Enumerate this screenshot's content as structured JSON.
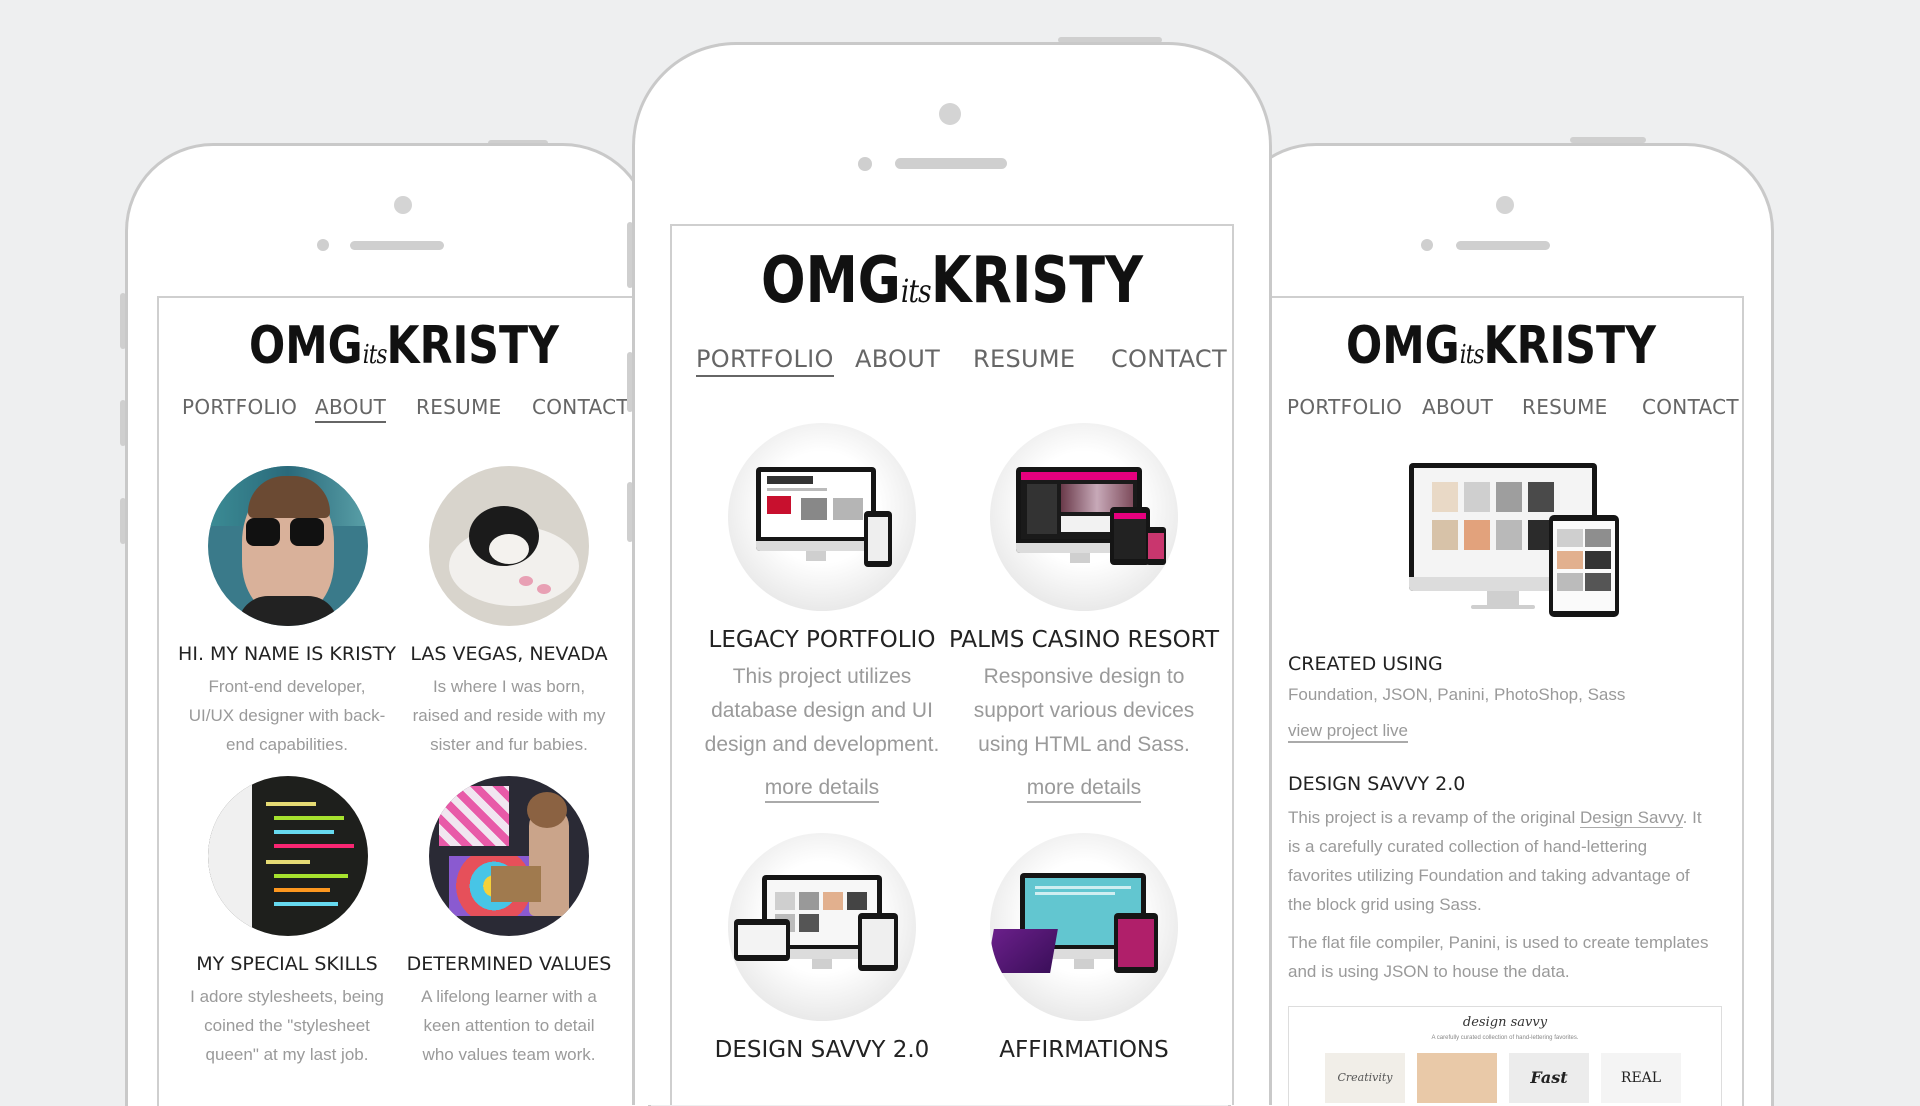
{
  "logo": {
    "left": "OMG",
    "its": "its",
    "right": "KRISTY"
  },
  "nav": {
    "portfolio": "PORTFOLIO",
    "about": "ABOUT",
    "resume": "RESUME",
    "contact": "CONTACT"
  },
  "about": {
    "cards": [
      {
        "title": "HI. MY NAME IS KRISTY",
        "lines": [
          "Front-end developer,",
          "UI/UX designer with back-",
          "end capabilities."
        ]
      },
      {
        "title": "LAS VEGAS, NEVADA",
        "lines": [
          "Is where I was born,",
          "raised and reside with my",
          "sister and fur babies."
        ]
      },
      {
        "title": "MY SPECIAL SKILLS",
        "lines": [
          "I adore stylesheets, being",
          "coined the \"stylesheet",
          "queen\" at my last job."
        ]
      },
      {
        "title": "DETERMINED VALUES",
        "lines": [
          "A lifelong learner with a",
          "keen attention to detail",
          "who values team work."
        ]
      }
    ]
  },
  "portfolio": {
    "cards": [
      {
        "title": "LEGACY PORTFOLIO",
        "lines": [
          "This project utilizes",
          "database design and UI",
          "design and development."
        ],
        "link": "more details"
      },
      {
        "title": "PALMS CASINO RESORT",
        "lines": [
          "Responsive design to",
          "support various devices",
          "using HTML and Sass."
        ],
        "link": "more details"
      },
      {
        "title": "DESIGN SAVVY 2.0"
      },
      {
        "title": "AFFIRMATIONS"
      }
    ]
  },
  "detail": {
    "created_title": "CREATED USING",
    "created_text": "Foundation, JSON, Panini, PhotoShop, Sass",
    "view_live": "view project live",
    "project_title": "DESIGN SAVVY 2.0",
    "para1_lines": [
      [
        "This project is a revamp of the original ",
        "Design Savvy",
        ". It"
      ],
      [
        "is a carefully curated collection of hand-lettering"
      ],
      [
        "favorites utilizing Foundation and taking advantage of"
      ],
      [
        "the block grid using Sass."
      ]
    ],
    "para2_lines": [
      "The flat file compiler, Panini, is used to create templates",
      "and is using JSON to house the data."
    ],
    "preview_title": "design savvy",
    "preview_sub": "A carefully curated collection of hand-lettering favorites.",
    "preview_tiles": [
      "Creativity",
      "",
      "Fast",
      "REAL"
    ]
  },
  "colors": {
    "background": "#eeeff0",
    "phone_frame": "#c9c9c9",
    "nav_text": "#666666",
    "body_text": "#9a9a9a",
    "title_text": "#222222"
  }
}
